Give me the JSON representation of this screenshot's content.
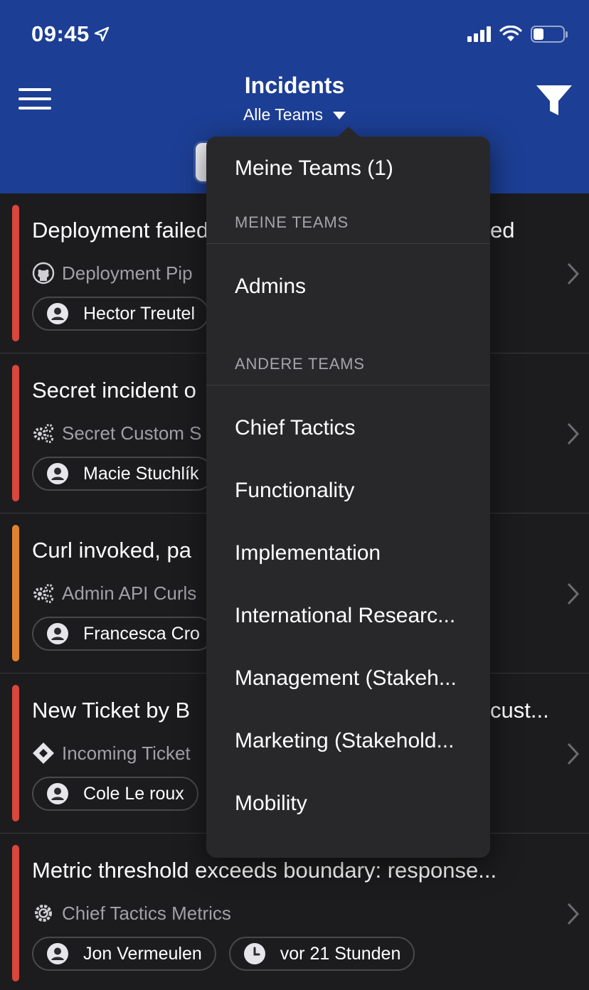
{
  "status_bar": {
    "time": "09:45"
  },
  "header": {
    "title": "Incidents",
    "subtitle": "Alle Teams",
    "bg_color": "#1c3e94"
  },
  "incidents": [
    {
      "title": "Deployment failed",
      "title_tail": "ed",
      "source": "Deployment Pip",
      "source_icon": "github-icon",
      "assignee": "Hector Treutel",
      "color": "#d9463c"
    },
    {
      "title": "Secret incident o",
      "source": "Secret Custom S",
      "source_icon": "gears-icon",
      "assignee": "Macie Stuchlík",
      "color": "#d9463c"
    },
    {
      "title": "Curl invoked, pa",
      "source": "Admin API Curls",
      "source_icon": "gears-icon",
      "assignee": "Francesca Cro",
      "color": "#e0822f"
    },
    {
      "title": "New Ticket by B",
      "title_tail": "cust...",
      "source": "Incoming Ticket",
      "source_icon": "jira-diamond-icon",
      "assignee": "Cole Le roux",
      "color": "#d9463c"
    },
    {
      "title": "Metric threshold exceeds boundary: response...",
      "source": "Chief Tactics Metrics",
      "source_icon": "grafana-icon",
      "assignee": "Jon Vermeulen",
      "time": "vor 21 Stunden",
      "color": "#d9463c"
    }
  ],
  "dropdown": {
    "top_item": "Meine Teams (1)",
    "section_mine": "MEINE TEAMS",
    "mine": [
      "Admins"
    ],
    "section_other": "ANDERE TEAMS",
    "other": [
      "Chief Tactics",
      "Functionality",
      "Implementation",
      "International Researc...",
      "Management (Stakeh...",
      "Marketing (Stakehold...",
      "Mobility"
    ]
  }
}
